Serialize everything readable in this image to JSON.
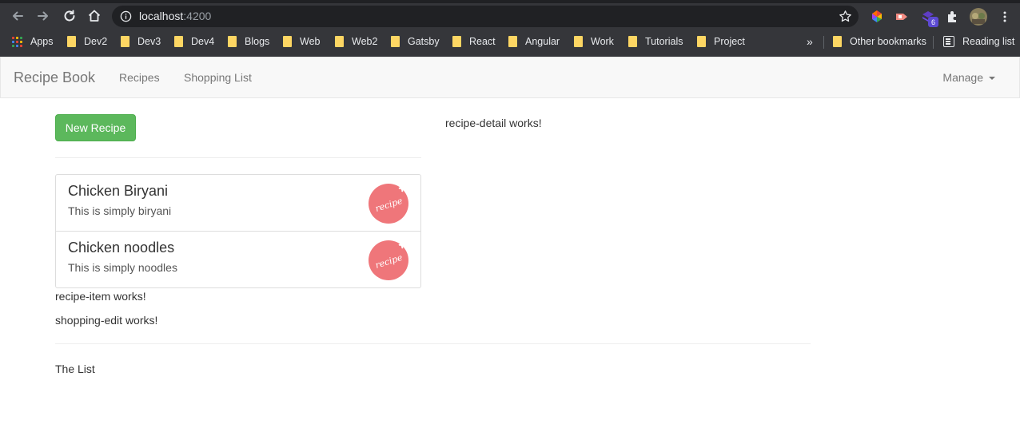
{
  "browser": {
    "url_host": "localhost",
    "url_port": ":4200",
    "extension_badge": "6",
    "bookmarks": [
      {
        "label": "Apps"
      },
      {
        "label": "Dev2"
      },
      {
        "label": "Dev3"
      },
      {
        "label": "Dev4"
      },
      {
        "label": "Blogs"
      },
      {
        "label": "Web"
      },
      {
        "label": "Web2"
      },
      {
        "label": "Gatsby"
      },
      {
        "label": "React"
      },
      {
        "label": "Angular"
      },
      {
        "label": "Work"
      },
      {
        "label": "Tutorials"
      },
      {
        "label": "Project"
      }
    ],
    "overflow_label": "»",
    "other_bookmarks": "Other bookmarks",
    "reading_list": "Reading list"
  },
  "navbar": {
    "brand": "Recipe Book",
    "links": [
      {
        "label": "Recipes"
      },
      {
        "label": "Shopping List"
      }
    ],
    "manage": "Manage"
  },
  "recipes": {
    "new_button": "New Recipe",
    "detail_text": "recipe-detail works!",
    "items": [
      {
        "name": "Chicken Biryani",
        "description": "This is simply biryani",
        "image_text": "recipe"
      },
      {
        "name": "Chicken noodles",
        "description": "This is simply noodles",
        "image_text": "recipe"
      }
    ],
    "item_works": "recipe-item works!"
  },
  "shopping": {
    "edit_works": "shopping-edit works!",
    "list_text": "The List"
  },
  "colors": {
    "success": "#5cb85c",
    "recipe_badge": "#ef767a",
    "navbar_bg": "#f8f8f8",
    "chrome_bg": "#35363a"
  }
}
